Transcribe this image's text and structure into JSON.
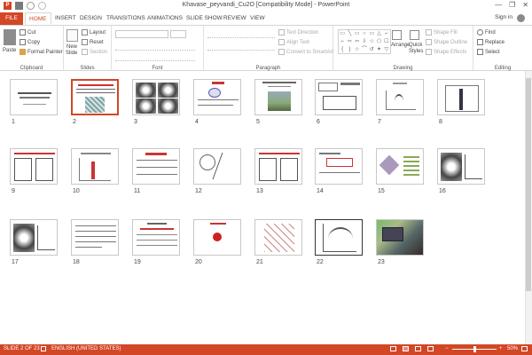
{
  "window": {
    "title": "Khavase_peyvandi_Cu2O [Compatibility Mode] - PowerPoint",
    "app_glyph": "P",
    "min_glyph": "—",
    "restore_glyph": "❐",
    "close_glyph": "✕"
  },
  "tabs": [
    "FILE",
    "HOME",
    "INSERT",
    "DESIGN",
    "TRANSITIONS",
    "ANIMATIONS",
    "SLIDE SHOW",
    "REVIEW",
    "VIEW"
  ],
  "signin": "Sign in",
  "ribbon": {
    "clipboard": {
      "paste": "Paste",
      "cut": "Cut",
      "copy": "Copy",
      "format_painter": "Format Painter",
      "label": "Clipboard"
    },
    "slides": {
      "new_slide": "New",
      "new_slide2": "Slide",
      "layout": "Layout",
      "reset": "Reset",
      "section": "Section",
      "label": "Slides"
    },
    "font": {
      "label": "Font"
    },
    "paragraph": {
      "text_direction": "Text Direction",
      "align_text": "Align Text",
      "convert_smartart": "Convert to SmartArt",
      "label": "Paragraph"
    },
    "drawing": {
      "arrange": "Arrange",
      "quick_styles": "Quick",
      "quick_styles2": "Styles",
      "shape_fill": "Shape Fill",
      "shape_outline": "Shape Outline",
      "shape_effects": "Shape Effects",
      "label": "Drawing"
    },
    "editing": {
      "find": "Find",
      "replace": "Replace",
      "select": "Select",
      "label": "Editing"
    }
  },
  "slides": [
    {
      "n": "1"
    },
    {
      "n": "2"
    },
    {
      "n": "3"
    },
    {
      "n": "4"
    },
    {
      "n": "5"
    },
    {
      "n": "6"
    },
    {
      "n": "7"
    },
    {
      "n": "8"
    },
    {
      "n": "9"
    },
    {
      "n": "10"
    },
    {
      "n": "11"
    },
    {
      "n": "12"
    },
    {
      "n": "13"
    },
    {
      "n": "14"
    },
    {
      "n": "15"
    },
    {
      "n": "16"
    },
    {
      "n": "17"
    },
    {
      "n": "18"
    },
    {
      "n": "19"
    },
    {
      "n": "20"
    },
    {
      "n": "21"
    },
    {
      "n": "22"
    },
    {
      "n": "23"
    }
  ],
  "status": {
    "slide": "SLIDE 2 OF 23",
    "language": "ENGLISH (UNITED STATES)",
    "zoom": "50%",
    "zoom_minus": "−",
    "zoom_plus": "+"
  },
  "colors": {
    "accent": "#d24726"
  }
}
